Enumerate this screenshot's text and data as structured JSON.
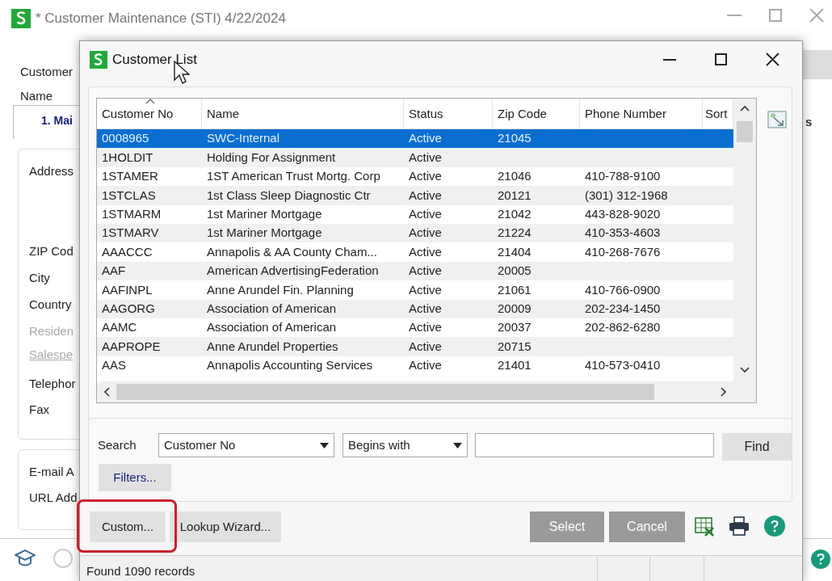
{
  "window": {
    "title": "* Customer Maintenance (STI) 4/22/2024"
  },
  "background_form": {
    "header_labels": [
      "Customer",
      "Name"
    ],
    "tab": "1. Mai",
    "tab_right": "s",
    "address_labels": [
      "Address",
      "ZIP Cod",
      "City",
      "Country"
    ],
    "disabled_labels": [
      "Residen",
      "Salespe"
    ],
    "phone_labels": [
      "Telephor",
      "Fax"
    ],
    "web_labels": [
      "E-mail A",
      "URL Add"
    ]
  },
  "dialog": {
    "title": "Customer List",
    "columns": [
      "Customer No",
      "Name",
      "Status",
      "Zip Code",
      "Phone Number",
      "Sort"
    ],
    "rows": [
      {
        "cells": [
          "0008965",
          "SWC-Internal",
          "Active",
          "21045",
          ""
        ],
        "selected": true
      },
      {
        "cells": [
          "1HOLDIT",
          "Holding For Assignment",
          "Active",
          "",
          ""
        ],
        "selected": false
      },
      {
        "cells": [
          "1STAMER",
          "1ST American Trust Mortg. Corp",
          "Active",
          "21046",
          "410-788-9100"
        ],
        "selected": false
      },
      {
        "cells": [
          "1STCLAS",
          "1st Class Sleep Diagnostic Ctr",
          "Active",
          "20121",
          "(301) 312-1968"
        ],
        "selected": false
      },
      {
        "cells": [
          "1STMARM",
          "1st Mariner Mortgage",
          "Active",
          "21042",
          "443-828-9020"
        ],
        "selected": false
      },
      {
        "cells": [
          "1STMARV",
          "1st Mariner Mortgage",
          "Active",
          "21224",
          "410-353-4603"
        ],
        "selected": false
      },
      {
        "cells": [
          "AAACCC",
          "Annapolis & AA County Cham...",
          "Active",
          "21404",
          "410-268-7676"
        ],
        "selected": false
      },
      {
        "cells": [
          "AAF",
          "American AdvertisingFederation",
          "Active",
          "20005",
          ""
        ],
        "selected": false
      },
      {
        "cells": [
          "AAFINPL",
          "Anne Arundel Fin. Planning",
          "Active",
          "21061",
          "410-766-0900"
        ],
        "selected": false
      },
      {
        "cells": [
          "AAGORG",
          "Association of American",
          "Active",
          "20009",
          "202-234-1450"
        ],
        "selected": false
      },
      {
        "cells": [
          "AAMC",
          "Association of American",
          "Active",
          "20037",
          "202-862-6280"
        ],
        "selected": false
      },
      {
        "cells": [
          "AAPROPE",
          "Anne Arundel Properties",
          "Active",
          "20715",
          ""
        ],
        "selected": false
      },
      {
        "cells": [
          "AAS",
          "Annapolis Accounting Services",
          "Active",
          "21401",
          "410-573-0410"
        ],
        "selected": false
      }
    ],
    "search": {
      "label": "Search",
      "field": "Customer No",
      "operator": "Begins with",
      "find": "Find",
      "filters": "Filters..."
    },
    "buttons": {
      "custom": "Custom...",
      "wizard": "Lookup Wizard...",
      "select": "Select",
      "cancel": "Cancel"
    },
    "status_bar": "Found 1090 records"
  }
}
